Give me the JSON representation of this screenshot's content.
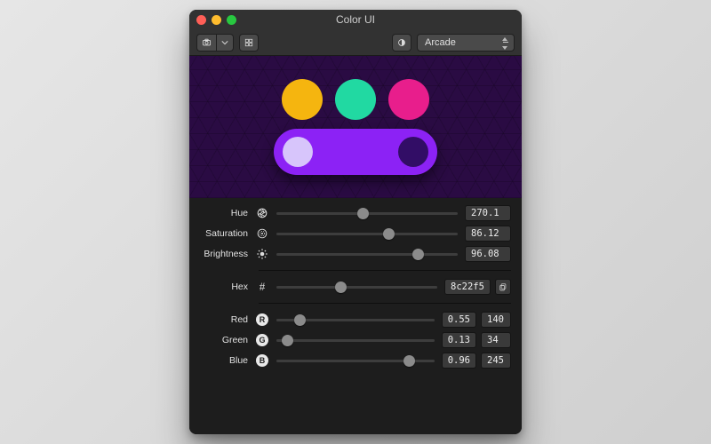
{
  "window": {
    "title": "Color UI"
  },
  "toolbar": {
    "theme_select_label": "Arcade"
  },
  "traffic_lights": {
    "close": "#ff5f57",
    "min": "#febc2e",
    "max": "#28c840"
  },
  "preview": {
    "bg": "#2a0b43",
    "swatches": [
      {
        "name": "swatch-yellow",
        "color": "#f5b50f"
      },
      {
        "name": "swatch-teal",
        "color": "#21d9a2"
      },
      {
        "name": "swatch-magenta",
        "color": "#e81e8c"
      }
    ],
    "token": {
      "bg": "#8c22f5",
      "knob_light": "#d7c5fb",
      "knob_dark": "#320d66"
    }
  },
  "sliders": {
    "hue": {
      "label": "Hue",
      "value": "270.1",
      "pct": 48
    },
    "saturation": {
      "label": "Saturation",
      "value": "86.12",
      "pct": 62
    },
    "brightness": {
      "label": "Brightness",
      "value": "96.08",
      "pct": 78
    },
    "hex": {
      "label": "Hex",
      "value": "8c22f5",
      "pct": 40
    },
    "red": {
      "label": "Red",
      "frac": "0.55",
      "int": "140",
      "pct": 15
    },
    "green": {
      "label": "Green",
      "frac": "0.13",
      "int": "34",
      "pct": 7
    },
    "blue": {
      "label": "Blue",
      "frac": "0.96",
      "int": "245",
      "pct": 84
    }
  },
  "icons": {
    "hash": "#",
    "r": "R",
    "g": "G",
    "b": "B"
  }
}
